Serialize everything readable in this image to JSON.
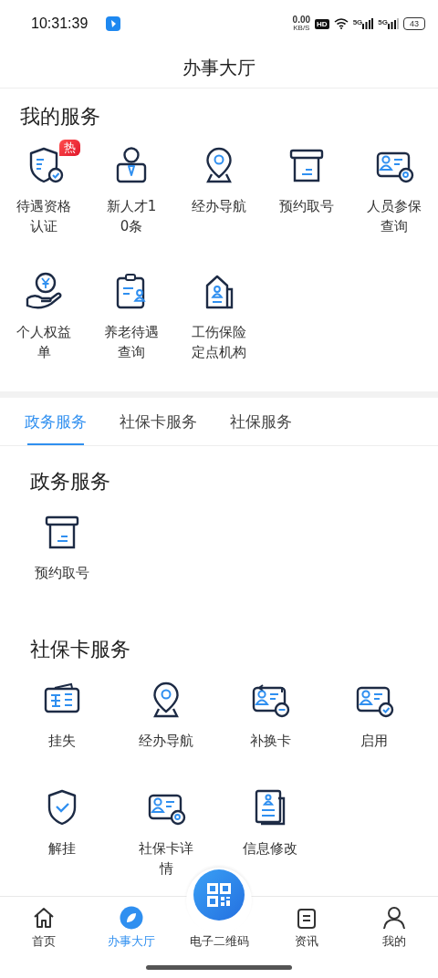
{
  "status_bar": {
    "time": "10:31:39",
    "net_speed": "0.00",
    "net_unit": "KB/S",
    "hd": "HD",
    "signal_1": "5G",
    "signal_2": "5G",
    "battery": "43"
  },
  "header": {
    "title": "办事大厅"
  },
  "my_services": {
    "title": "我的服务",
    "items": [
      {
        "label": "待遇资格认证",
        "kind": "shield-badge",
        "badge": "热"
      },
      {
        "label": "新人才10条",
        "kind": "person-tie"
      },
      {
        "label": "经办导航",
        "kind": "pin"
      },
      {
        "label": "预约取号",
        "kind": "ticket"
      },
      {
        "label": "人员参保查询",
        "kind": "card-search"
      },
      {
        "label": "个人权益单",
        "kind": "coin-hand"
      },
      {
        "label": "养老待遇查询",
        "kind": "clipboard-person"
      },
      {
        "label": "工伤保险定点机构",
        "kind": "house-person"
      }
    ]
  },
  "tabs": [
    {
      "label": "政务服务",
      "selected": true
    },
    {
      "label": "社保卡服务",
      "selected": false
    },
    {
      "label": "社保服务",
      "selected": false
    }
  ],
  "sections": [
    {
      "title": "政务服务",
      "items": [
        {
          "label": "预约取号",
          "kind": "ticket"
        }
      ]
    },
    {
      "title": "社保卡服务",
      "items": [
        {
          "label": "挂失",
          "kind": "card-lines"
        },
        {
          "label": "经办导航",
          "kind": "pin"
        },
        {
          "label": "补换卡",
          "kind": "card-swap"
        },
        {
          "label": "启用",
          "kind": "card-check"
        },
        {
          "label": "解挂",
          "kind": "shield-check"
        },
        {
          "label": "社保卡详情",
          "kind": "card-search"
        },
        {
          "label": "信息修改",
          "kind": "doc-person"
        }
      ]
    }
  ],
  "bottom_nav": [
    {
      "label": "首页",
      "kind": "home",
      "selected": false
    },
    {
      "label": "办事大厅",
      "kind": "leaf",
      "selected": true
    },
    {
      "label": "电子二维码",
      "kind": "qr",
      "selected": false
    },
    {
      "label": "资讯",
      "kind": "clipboard",
      "selected": false
    },
    {
      "label": "我的",
      "kind": "person",
      "selected": false
    }
  ]
}
